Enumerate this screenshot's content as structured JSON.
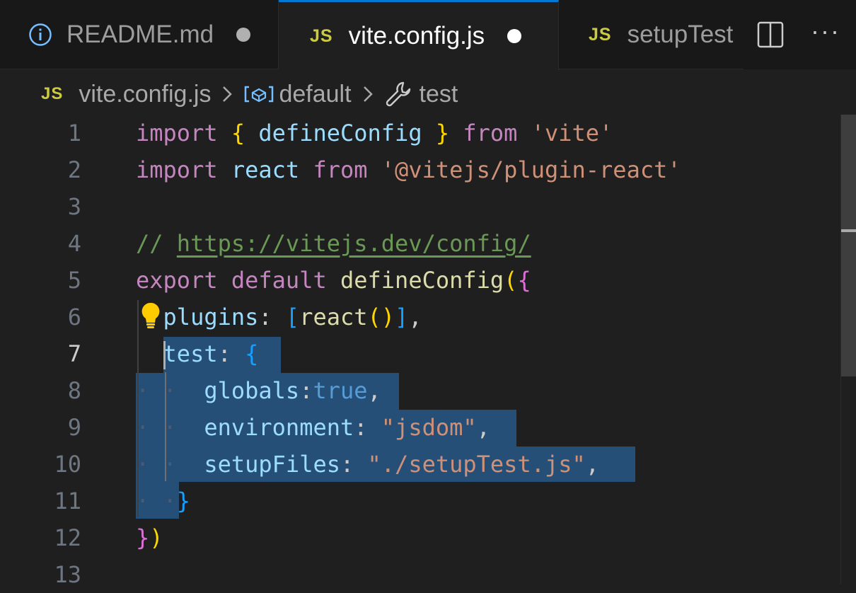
{
  "tabs": [
    {
      "label": "README.md",
      "icon": "info-icon",
      "dirty": true,
      "active": false
    },
    {
      "label": "vite.config.js",
      "icon": "js-icon",
      "dirty": true,
      "active": true
    },
    {
      "label": "setupTest",
      "icon": "js-icon",
      "active": false
    }
  ],
  "tab_icon_text": "JS",
  "breadcrumb": {
    "file": "vite.config.js",
    "symbol": "default",
    "property": "test"
  },
  "editor": {
    "current_line": 7,
    "line_numbers": [
      "1",
      "2",
      "3",
      "4",
      "5",
      "6",
      "7",
      "8",
      "9",
      "10",
      "11",
      "12",
      "13"
    ],
    "lines": [
      [
        {
          "t": "import",
          "c": "kw"
        },
        {
          "t": " ",
          "c": "pun"
        },
        {
          "t": "{",
          "c": "br1"
        },
        {
          "t": " defineConfig ",
          "c": "var"
        },
        {
          "t": "}",
          "c": "br1"
        },
        {
          "t": " ",
          "c": "pun"
        },
        {
          "t": "from",
          "c": "kw"
        },
        {
          "t": " ",
          "c": "pun"
        },
        {
          "t": "'vite'",
          "c": "str"
        }
      ],
      [
        {
          "t": "import",
          "c": "kw"
        },
        {
          "t": " react ",
          "c": "var"
        },
        {
          "t": "from",
          "c": "kw"
        },
        {
          "t": " ",
          "c": "pun"
        },
        {
          "t": "'@vitejs/plugin-react'",
          "c": "str"
        }
      ],
      [],
      [
        {
          "t": "// ",
          "c": "cm"
        },
        {
          "t": "https://vitejs.dev/config/",
          "c": "lnk"
        }
      ],
      [
        {
          "t": "export",
          "c": "kw"
        },
        {
          "t": " ",
          "c": "pun"
        },
        {
          "t": "default",
          "c": "kw"
        },
        {
          "t": " ",
          "c": "pun"
        },
        {
          "t": "defineConfig",
          "c": "fn"
        },
        {
          "t": "(",
          "c": "br1"
        },
        {
          "t": "{",
          "c": "br2"
        }
      ],
      [
        {
          "t": "  ",
          "c": "pun"
        },
        {
          "t": "plugins",
          "c": "var"
        },
        {
          "t": ": ",
          "c": "pun"
        },
        {
          "t": "[",
          "c": "br3"
        },
        {
          "t": "react",
          "c": "fn"
        },
        {
          "t": "()",
          "c": "br1"
        },
        {
          "t": "]",
          "c": "br3"
        },
        {
          "t": ",",
          "c": "pun"
        }
      ],
      [
        {
          "t": "  ",
          "c": "pun"
        },
        {
          "t": "test",
          "c": "var"
        },
        {
          "t": ": ",
          "c": "pun"
        },
        {
          "t": "{",
          "c": "br3"
        }
      ],
      [
        {
          "t": "· · ",
          "c": "ws"
        },
        {
          "t": " ",
          "c": "pun"
        },
        {
          "t": "globals",
          "c": "var"
        },
        {
          "t": ":",
          "c": "pun"
        },
        {
          "t": "true",
          "c": "bool"
        },
        {
          "t": ",",
          "c": "pun"
        }
      ],
      [
        {
          "t": "· · ",
          "c": "ws"
        },
        {
          "t": " ",
          "c": "pun"
        },
        {
          "t": "environment",
          "c": "var"
        },
        {
          "t": ": ",
          "c": "pun"
        },
        {
          "t": "\"jsdom\"",
          "c": "str"
        },
        {
          "t": ",",
          "c": "pun"
        }
      ],
      [
        {
          "t": "· · ",
          "c": "ws"
        },
        {
          "t": " ",
          "c": "pun"
        },
        {
          "t": "setupFiles",
          "c": "var"
        },
        {
          "t": ": ",
          "c": "pun"
        },
        {
          "t": "\"./setupTest.js\"",
          "c": "str"
        },
        {
          "t": ",",
          "c": "pun"
        }
      ],
      [
        {
          "t": "· ·",
          "c": "ws"
        },
        {
          "t": "}",
          "c": "br3"
        }
      ],
      [
        {
          "t": "}",
          "c": "br2"
        },
        {
          "t": ")",
          "c": "br1"
        }
      ],
      []
    ]
  }
}
